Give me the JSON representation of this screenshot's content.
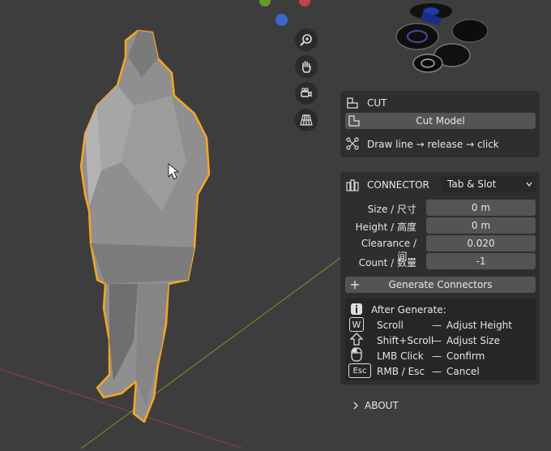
{
  "cut": {
    "title": "CUT",
    "cut_model_label": "Cut Model",
    "hint": "Draw line → release → click"
  },
  "connector": {
    "title": "CONNECTOR",
    "type_value": "Tab & Slot",
    "fields": [
      {
        "label": "Size / 尺寸",
        "value": "0 m"
      },
      {
        "label": "Height / 高度",
        "value": "0 m"
      },
      {
        "label": "Clearance / 间...",
        "value": "0.020"
      },
      {
        "label": "Count / 数量",
        "value": "-1"
      }
    ],
    "generate_label": "Generate Connectors"
  },
  "help": {
    "heading": "After Generate:",
    "rows": [
      {
        "key": "Scroll",
        "sep": "—",
        "action": "Adjust Height"
      },
      {
        "key": "Shift+Scroll",
        "sep": "—",
        "action": "Adjust Size"
      },
      {
        "key": "LMB Click",
        "sep": "—",
        "action": "Confirm"
      },
      {
        "key": "RMB / Esc",
        "sep": "—",
        "action": "Cancel"
      }
    ],
    "esc_icon_text": "Esc",
    "w_icon_text": "W"
  },
  "about": {
    "title": "ABOUT"
  },
  "colors": {
    "viewport_bg": "#3d3d3d",
    "panel_bg": "#2e2e2e",
    "field_bg": "#545454",
    "selection_outline": "#f5a623",
    "x_axis": "#9e3a45",
    "y_axis": "#7a9a2e"
  }
}
